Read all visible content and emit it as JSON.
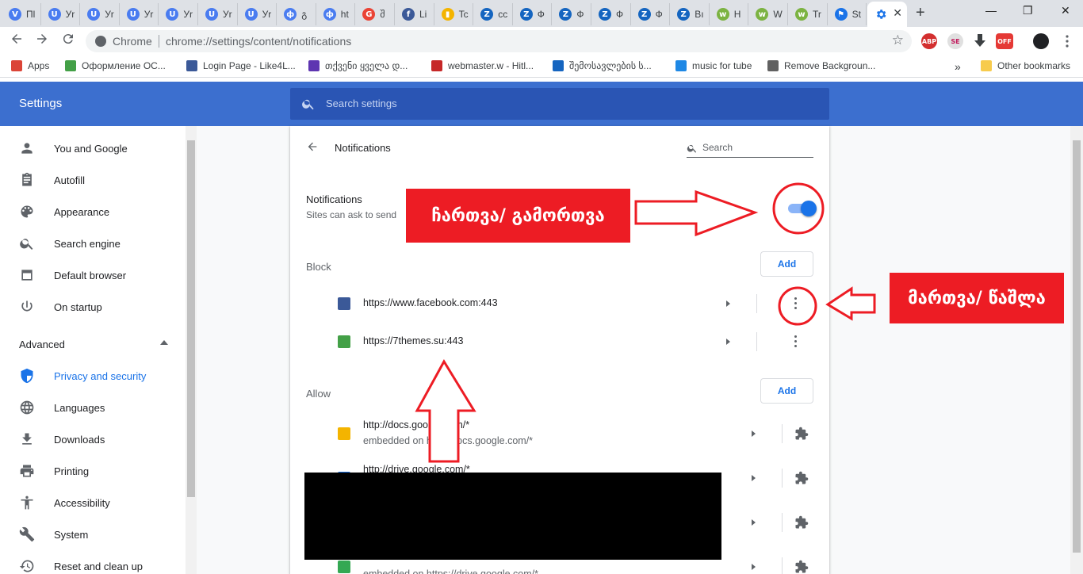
{
  "browser": {
    "tabs": [
      {
        "title": "Пl",
        "color": "#4a7cf0",
        "glyph": "V"
      },
      {
        "title": "Уr",
        "color": "#4a7cf0",
        "glyph": "U"
      },
      {
        "title": "Уr",
        "color": "#4a7cf0",
        "glyph": "U"
      },
      {
        "title": "Уr",
        "color": "#4a7cf0",
        "glyph": "U"
      },
      {
        "title": "Уr",
        "color": "#4a7cf0",
        "glyph": "U"
      },
      {
        "title": "Уr",
        "color": "#4a7cf0",
        "glyph": "U"
      },
      {
        "title": "Уr",
        "color": "#4a7cf0",
        "glyph": "U"
      },
      {
        "title": "გ",
        "color": "#4a7cf0",
        "glyph": "ф"
      },
      {
        "title": "ht",
        "color": "#4a7cf0",
        "glyph": "ф"
      },
      {
        "title": "შ",
        "color": "#ea4335",
        "glyph": "G"
      },
      {
        "title": "Li",
        "color": "#3b5998",
        "glyph": "f"
      },
      {
        "title": "Tc",
        "color": "#f4b400",
        "glyph": "▮"
      },
      {
        "title": "cc",
        "color": "#1565c0",
        "glyph": "Z"
      },
      {
        "title": "Ф",
        "color": "#1565c0",
        "glyph": "Z"
      },
      {
        "title": "Ф",
        "color": "#1565c0",
        "glyph": "Z"
      },
      {
        "title": "Ф",
        "color": "#1565c0",
        "glyph": "Z"
      },
      {
        "title": "Ф",
        "color": "#1565c0",
        "glyph": "Z"
      },
      {
        "title": "Bı",
        "color": "#1565c0",
        "glyph": "Z"
      },
      {
        "title": "H",
        "color": "#7cb342",
        "glyph": "w"
      },
      {
        "title": "W",
        "color": "#7cb342",
        "glyph": "w"
      },
      {
        "title": "Tr",
        "color": "#7cb342",
        "glyph": "w"
      },
      {
        "title": "St",
        "color": "#1a73e8",
        "glyph": "⚑"
      }
    ],
    "active_tab_icon": "gear-icon",
    "omnibox": {
      "scheme_label": "Chrome",
      "url": "chrome://settings/content/notifications"
    },
    "extensions": [
      {
        "label": "ABP",
        "color": "#d32f2f"
      },
      {
        "label": "SE",
        "color": "#e0e0e0"
      },
      {
        "label": "OFF",
        "color": "#e53935"
      }
    ],
    "bookmarks": [
      {
        "label": "Apps",
        "color": "#db4437"
      },
      {
        "label": "Оформление ОС...",
        "color": "#43a047"
      },
      {
        "label": "Login Page - Like4L...",
        "color": "#3b5998"
      },
      {
        "label": "თქვენი ყველა დ...",
        "color": "#5e35b1"
      },
      {
        "label": "webmaster.w - Hitl...",
        "color": "#c62828"
      },
      {
        "label": "შემოსავლების ს...",
        "color": "#1565c0"
      },
      {
        "label": "music for tube",
        "color": "#1e88e5"
      },
      {
        "label": "Remove Backgroun...",
        "color": "#616161"
      }
    ],
    "bookmarks_overflow": "»",
    "other_bookmarks": "Other bookmarks"
  },
  "settings": {
    "title": "Settings",
    "search_placeholder": "Search settings",
    "sidebar": [
      {
        "label": "You and Google",
        "icon": "person-icon"
      },
      {
        "label": "Autofill",
        "icon": "clipboard-icon"
      },
      {
        "label": "Appearance",
        "icon": "palette-icon"
      },
      {
        "label": "Search engine",
        "icon": "search-icon"
      },
      {
        "label": "Default browser",
        "icon": "browser-icon"
      },
      {
        "label": "On startup",
        "icon": "power-icon"
      }
    ],
    "advanced_label": "Advanced",
    "advanced_items": [
      {
        "label": "Privacy and security",
        "icon": "shield-icon",
        "active": true
      },
      {
        "label": "Languages",
        "icon": "globe-icon"
      },
      {
        "label": "Downloads",
        "icon": "download-icon"
      },
      {
        "label": "Printing",
        "icon": "printer-icon"
      },
      {
        "label": "Accessibility",
        "icon": "accessibility-icon"
      },
      {
        "label": "System",
        "icon": "wrench-icon"
      },
      {
        "label": "Reset and clean up",
        "icon": "restore-icon"
      }
    ],
    "accent": "#1a73e8",
    "header_color": "#3c6fcf"
  },
  "page": {
    "title": "Notifications",
    "search_placeholder": "Search",
    "notifications_label": "Notifications",
    "notifications_sub": "Sites can ask to send",
    "toggle_on": true,
    "block_label": "Block",
    "allow_label": "Allow",
    "add_label": "Add",
    "block_sites": [
      {
        "url": "https://www.facebook.com:443",
        "icon_color": "#3b5998"
      },
      {
        "url": "https://7themes.su:443",
        "icon_color": "#43a047"
      }
    ],
    "allow_sites": [
      {
        "url": "http://docs.google.com/*",
        "embedded": "embedded on http://docs.google.com/*",
        "icon_color": "#f4b400"
      },
      {
        "url": "http://drive.google.com/*",
        "embedded": "",
        "icon_color": "#1a73e8"
      },
      {
        "url": "",
        "embedded": "",
        "icon_color": "#1a73e8"
      },
      {
        "url": "",
        "embedded": "embedded on https://drive.google.com/*",
        "icon_color": "#34a853"
      }
    ]
  },
  "annotations": {
    "toggle_caption": "ჩართვა/  გამორთვა",
    "manage_caption": "მართვა/ წაშლა",
    "color": "#ed1c24"
  }
}
